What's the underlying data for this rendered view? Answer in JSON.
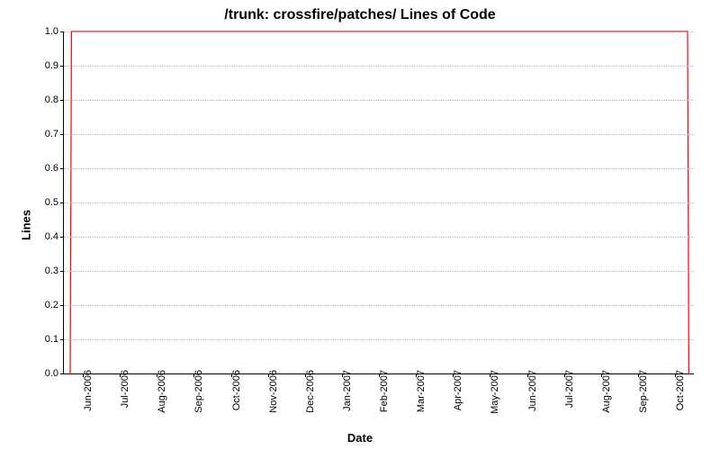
{
  "chart_data": {
    "type": "line",
    "title": "/trunk: crossfire/patches/ Lines of Code",
    "xlabel": "Date",
    "ylabel": "Lines",
    "ylim": [
      0.0,
      1.0
    ],
    "categories": [
      "Jun-2006",
      "Jul-2006",
      "Aug-2006",
      "Sep-2006",
      "Oct-2006",
      "Nov-2006",
      "Dec-2006",
      "Jan-2007",
      "Feb-2007",
      "Mar-2007",
      "Apr-2007",
      "May-2007",
      "Jun-2007",
      "Jul-2007",
      "Aug-2007",
      "Sep-2007",
      "Oct-2007"
    ],
    "y_ticks": [
      0.0,
      0.1,
      0.2,
      0.3,
      0.4,
      0.5,
      0.6,
      0.7,
      0.8,
      0.9,
      1.0
    ],
    "series_color": "#ff0000",
    "series": [
      {
        "name": "Lines",
        "points": [
          {
            "x_frac": 0.01,
            "y": 0.0
          },
          {
            "x_frac": 0.012,
            "y": 1.0
          },
          {
            "x_frac": 0.99,
            "y": 1.0
          },
          {
            "x_frac": 0.992,
            "y": 0.0
          }
        ]
      }
    ]
  }
}
